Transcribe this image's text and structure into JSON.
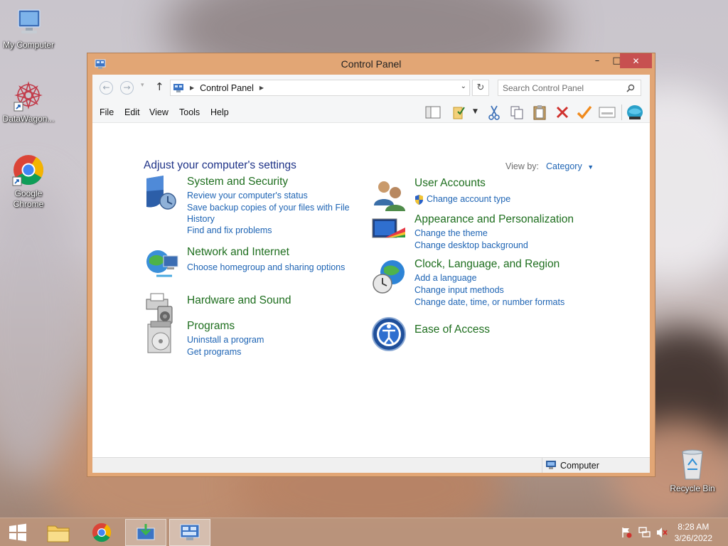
{
  "desktop": {
    "icons": [
      {
        "label": "My Computer"
      },
      {
        "label": "DataWagon..."
      },
      {
        "label": "Google Chrome"
      },
      {
        "label": "Recycle Bin"
      }
    ]
  },
  "window": {
    "title": "Control Panel",
    "buttons": {
      "minimize": "–",
      "maximize": "□",
      "close": "✕"
    },
    "address": {
      "breadcrumb": "Control Panel"
    },
    "search": {
      "placeholder": "Search Control Panel"
    },
    "menu": [
      "File",
      "Edit",
      "View",
      "Tools",
      "Help"
    ],
    "toolbar_icons": [
      "layout-icon",
      "folder-check-icon",
      "cut-icon",
      "copy-icon",
      "paste-icon",
      "delete-icon",
      "check-icon",
      "properties-icon",
      "globe-icon"
    ],
    "heading": "Adjust your computer's settings",
    "view_by_label": "View by:",
    "view_by_value": "Category",
    "categories_left": [
      {
        "title": "System and Security",
        "links": [
          "Review your computer's status",
          "Save backup copies of your files with File",
          "History",
          "Find and fix problems"
        ]
      },
      {
        "title": "Network and Internet",
        "links": [
          "Choose homegroup and sharing options"
        ]
      },
      {
        "title": "Hardware and Sound",
        "links": []
      },
      {
        "title": "Programs",
        "links": [
          "Uninstall a program",
          "Get programs"
        ]
      }
    ],
    "categories_right": [
      {
        "title": "User Accounts",
        "links": [
          "Change account type"
        ]
      },
      {
        "title": "Appearance and Personalization",
        "links": [
          "Change the theme",
          "Change desktop background"
        ]
      },
      {
        "title": "Clock, Language, and Region",
        "links": [
          "Add a language",
          "Change input methods",
          "Change date, time, or number formats"
        ]
      },
      {
        "title": "Ease of Access",
        "links": []
      }
    ],
    "status": "Computer"
  },
  "taskbar": {
    "time": "8:28 AM",
    "date": "3/26/2022"
  },
  "colors": {
    "window_frame": "#e2a675",
    "close_button": "#c75050",
    "heading": "#1e3287",
    "category_title": "#1e6e1e",
    "link": "#1e64b4"
  }
}
